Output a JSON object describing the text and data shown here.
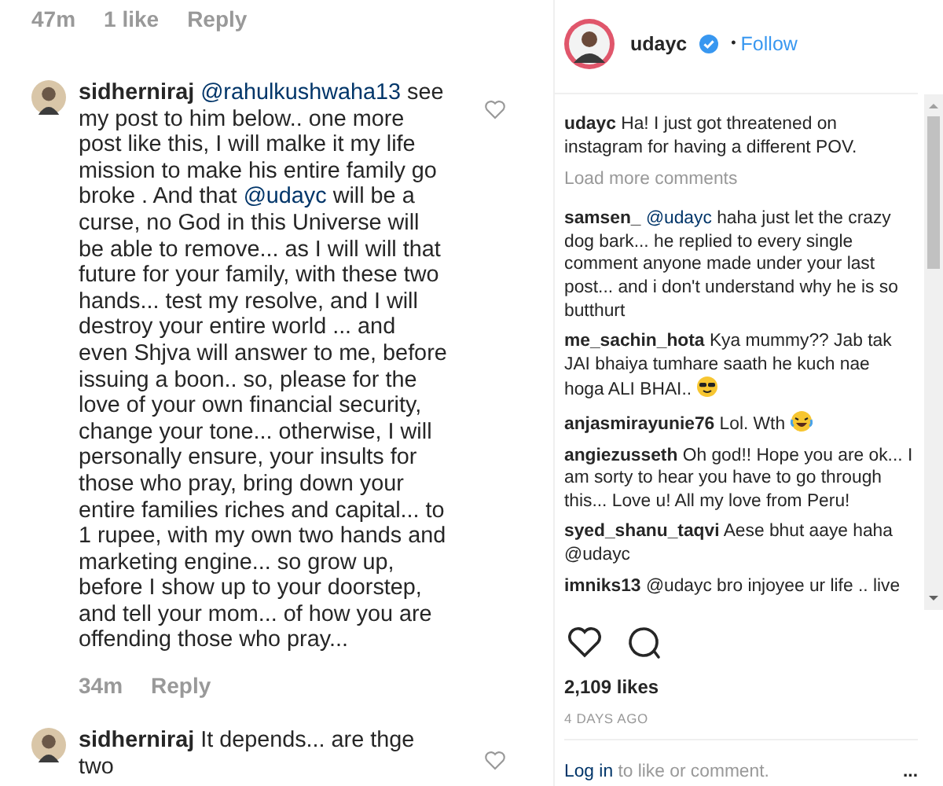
{
  "thread": {
    "previous_meta": {
      "time": "47m",
      "likes": "1 like",
      "reply": "Reply"
    },
    "comments": [
      {
        "username": "sidherniraj",
        "parts": [
          {
            "kind": "mention",
            "text": "@rahulkushwaha13"
          },
          {
            "kind": "text",
            "text": " see my post to him below.. one more post like this, I will malke it my life mission to make his entire family go broke .  And that "
          },
          {
            "kind": "mention",
            "text": "@udayc"
          },
          {
            "kind": "text",
            "text": " will be a curse, no God in this Universe will be able to remove... as I will will that future for your family, with these two hands... test my resolve, and I will destroy your entire world ... and even Shjva will answer to me, before issuing a boon.. so, please for the love of your own financial security, change your tone... otherwise, I will personally ensure, your insults for those who pray, bring down your entire families riches and capital... to 1 rupee, with my own two hands and marketing engine... so grow up, before I show up to your doorstep, and tell your mom... of how you are offending those who pray..."
          }
        ],
        "time": "34m",
        "reply": "Reply"
      },
      {
        "username": "sidherniraj",
        "parts": [
          {
            "kind": "text",
            "text": "It depends... are thge two"
          }
        ]
      }
    ]
  },
  "post": {
    "username": "udayc",
    "verified": true,
    "separator": "•",
    "follow": "Follow",
    "caption": {
      "username": "udayc",
      "parts": [
        {
          "kind": "text",
          "text": "Ha! I just got threatened on instagram for having a different POV."
        }
      ]
    },
    "load_more": "Load more comments",
    "comments": [
      {
        "username": "samsen_",
        "parts": [
          {
            "kind": "mention",
            "text": "@udayc"
          },
          {
            "kind": "text",
            "text": " haha just let the crazy dog bark... he replied to every single comment anyone made under your last post... and i don't understand why he is so butthurt"
          }
        ]
      },
      {
        "username": "me_sachin_hota",
        "parts": [
          {
            "kind": "text",
            "text": "Kya mummy?? Jab tak JAI bhaiya tumhare saath he kuch nae hoga ALI BHAI.. "
          },
          {
            "kind": "sunglasses"
          }
        ]
      },
      {
        "username": "anjasmirayunie76",
        "parts": [
          {
            "kind": "text",
            "text": "Lol. Wth "
          },
          {
            "kind": "laughing"
          }
        ]
      },
      {
        "username": "angiezusseth",
        "parts": [
          {
            "kind": "text",
            "text": "Oh god!! Hope you are ok... I am sorty to hear you have to go through this... Love u! All my love from Peru!"
          }
        ]
      },
      {
        "username": "syed_shanu_taqvi",
        "parts": [
          {
            "kind": "text",
            "text": "Aese bhut aaye haha "
          },
          {
            "kind": "text",
            "text": "@udayc"
          }
        ]
      },
      {
        "username": "imniks13",
        "parts": [
          {
            "kind": "text",
            "text": "@udayc bro injoyee ur life .. live"
          }
        ]
      }
    ],
    "likes": "2,109 likes",
    "date": "4 DAYS AGO",
    "login": {
      "link": "Log in",
      "text": "to like or comment."
    },
    "more": "..."
  }
}
